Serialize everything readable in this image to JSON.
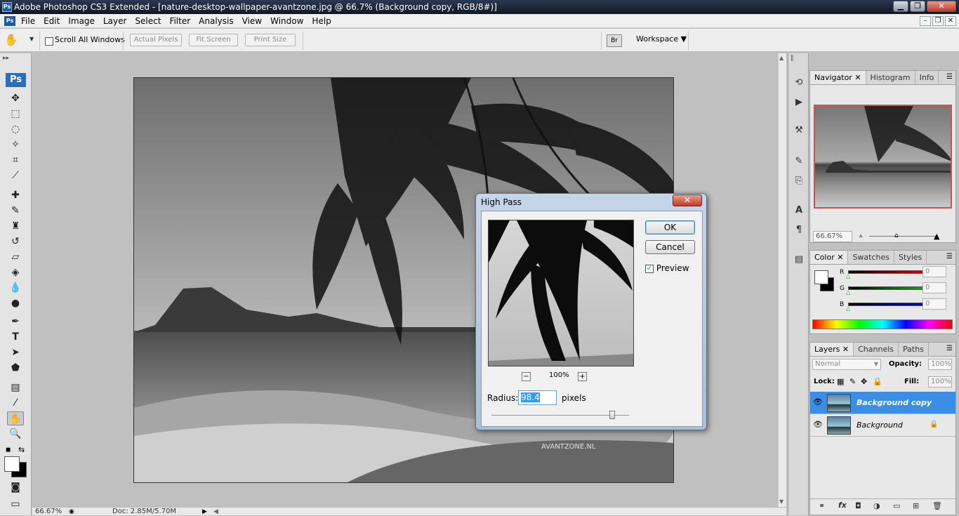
{
  "titlebar": {
    "app_icon": "Ps",
    "title": "Adobe Photoshop CS3 Extended - [nature-desktop-wallpaper-avantzone.jpg @ 66.7% (Background copy, RGB/8#)]",
    "minimize": "▁",
    "maximize": "❐",
    "close": "✕"
  },
  "menubar": {
    "items": [
      "File",
      "Edit",
      "Image",
      "Layer",
      "Select",
      "Filter",
      "Analysis",
      "View",
      "Window",
      "Help"
    ],
    "doc_minimize": "–",
    "doc_restore": "❐",
    "doc_close": "✕"
  },
  "options": {
    "scroll_all_windows": "Scroll All Windows",
    "actual_pixels": "Actual Pixels",
    "fit_screen": "Fit Screen",
    "print_size": "Print Size",
    "workspace": "Workspace ▼"
  },
  "toolbox": {
    "logo": "Ps"
  },
  "statusbar": {
    "zoom": "66.67%",
    "doc": "Doc: 2.85M/5.70M"
  },
  "navigator": {
    "tabs": [
      "Navigator",
      "Histogram",
      "Info"
    ],
    "zoom": "66.67%"
  },
  "color": {
    "tabs": [
      "Color",
      "Swatches",
      "Styles"
    ],
    "channels": [
      {
        "label": "R",
        "value": "0",
        "color": "#e00000"
      },
      {
        "label": "G",
        "value": "0",
        "color": "#00c000"
      },
      {
        "label": "B",
        "value": "0",
        "color": "#0000d0"
      }
    ]
  },
  "layers": {
    "tabs": [
      "Layers",
      "Channels",
      "Paths"
    ],
    "blend_mode": "Normal",
    "opacity_label": "Opacity:",
    "opacity": "100%",
    "lock_label": "Lock:",
    "fill_label": "Fill:",
    "fill": "100%",
    "items": [
      {
        "name": "Background copy",
        "selected": true,
        "locked": false
      },
      {
        "name": "Background",
        "selected": false,
        "locked": true
      }
    ],
    "fx": "fx"
  },
  "dialog": {
    "title": "High Pass",
    "close": "✕",
    "ok": "OK",
    "cancel": "Cancel",
    "preview_label": "Preview",
    "preview_checked": true,
    "zoom": "100%",
    "zoom_out": "−",
    "zoom_in": "+",
    "radius_label": "Radius:",
    "radius_value": "98.4",
    "radius_unit": "pixels",
    "watermark": "AVANTZONE.NL"
  }
}
